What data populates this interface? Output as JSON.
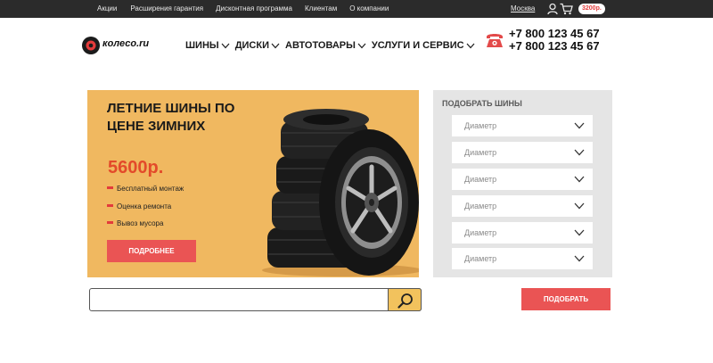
{
  "topbar": {
    "links": [
      "Акции",
      "Расширения гарантия",
      "Дисконтная программа",
      "Клиентам",
      "О компании"
    ],
    "city": "Москва",
    "cart_total": "3200р."
  },
  "header": {
    "logo_text": "колесо.ru",
    "nav": [
      "ШИНЫ",
      "ДИСКИ",
      "АВТОТОВАРЫ",
      "УСЛУГИ И СЕРВИС"
    ],
    "phones": [
      "+7 800 123 45 67",
      "+7 800 123 45 67"
    ]
  },
  "promo": {
    "title": "ЛЕТНИЕ ШИНЫ ПО ЦЕНЕ ЗИМНИХ",
    "price": "5600р.",
    "features": [
      "Бесплатный монтаж",
      "Оценка ремонта",
      "Вывоз мусора"
    ],
    "button": "ПОДРОБНЕЕ"
  },
  "picker": {
    "title": "ПОДОБРАТЬ ШИНЫ",
    "selects": [
      "Диаметр",
      "Диаметр",
      "Диаметр",
      "Диаметр",
      "Диаметр",
      "Диаметр"
    ],
    "button": "ПОДОБРАТЬ"
  },
  "search": {
    "value": "",
    "placeholder": ""
  },
  "colors": {
    "accent": "#ea5454",
    "banner": "#f0b860",
    "search_button": "#f2c25d",
    "topbar": "#2b2b2b"
  }
}
